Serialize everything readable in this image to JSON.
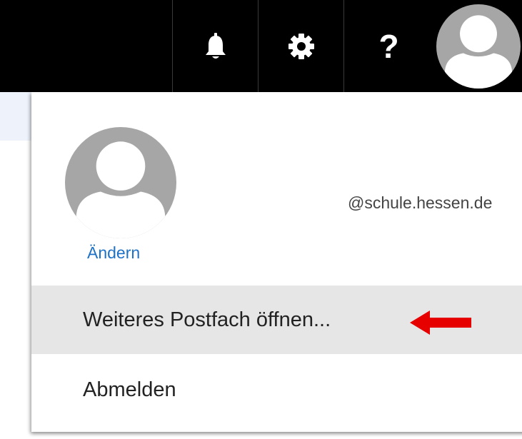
{
  "topbar": {
    "help_label": "?"
  },
  "account": {
    "email": "@schule.hessen.de",
    "change_label": "Ändern"
  },
  "menu": {
    "items": [
      {
        "label": "Weiteres Postfach öffnen..."
      },
      {
        "label": "Abmelden"
      }
    ]
  },
  "colors": {
    "topbar_background": "#000000",
    "link": "#1d72c7",
    "highlighted_item": "#e6e6e6",
    "annotation_arrow": "#e60000",
    "avatar_background": "#a6a6a6"
  },
  "icons": [
    "bell-icon",
    "gear-icon",
    "help-icon",
    "avatar-icon",
    "red-arrow-icon"
  ]
}
